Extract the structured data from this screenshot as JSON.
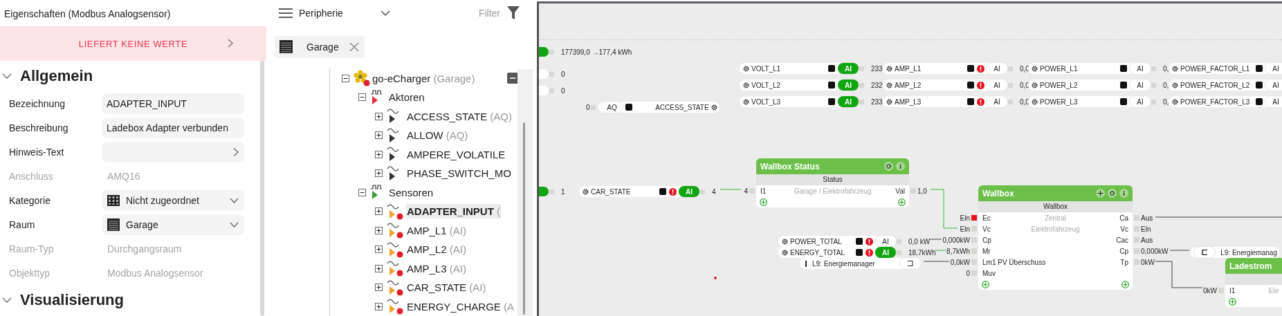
{
  "properties": {
    "title": "Eigenschaften (Modbus Analogsensor)",
    "status": "LIEFERT KEINE WERTE",
    "sections": [
      {
        "title": "Allgemein",
        "expanded": true,
        "fields": [
          {
            "label": "Bezeichnung",
            "value": "ADAPTER_INPUT",
            "kind": "text"
          },
          {
            "label": "Beschreibung",
            "value": "Ladebox Adapter verbunden",
            "kind": "text"
          },
          {
            "label": "Hinweis-Text",
            "kind": "link"
          },
          {
            "label": "Anschluss",
            "value": "AMQ16",
            "kind": "readonly"
          },
          {
            "label": "Kategorie",
            "value": "Nicht zugeordnet",
            "kind": "select"
          },
          {
            "label": "Raum",
            "value": "Garage",
            "kind": "select"
          },
          {
            "label": "Raum-Typ",
            "value": "Durchgangsraum",
            "kind": "readonly"
          },
          {
            "label": "Objekttyp",
            "value": "Modbus Analogsensor",
            "kind": "readonly"
          }
        ]
      },
      {
        "title": "Visualisierung",
        "expanded": true
      }
    ]
  },
  "periphery": {
    "view": "Peripherie",
    "filter": "Filter",
    "chips": [
      {
        "label": "Garage"
      }
    ],
    "tree": [
      {
        "name": "go-eCharger",
        "type": "(Garage)",
        "kind": "device",
        "expanded": true,
        "error": true,
        "selected": false,
        "children": [
          {
            "name": "Aktoren",
            "kind": "actuators",
            "expanded": true,
            "selected": false,
            "children": [
              {
                "name": "ACCESS_STATE",
                "type": "(AQ)",
                "kind": "output",
                "expanded": false,
                "error": false,
                "selected": false
              },
              {
                "name": "ALLOW",
                "type": "(AQ)",
                "kind": "output",
                "expanded": false,
                "error": false,
                "selected": false
              },
              {
                "name": "AMPERE_VOLATILE",
                "kind": "output",
                "expanded": false,
                "error": false,
                "selected": false
              },
              {
                "name": "PHASE_SWITCH_MO",
                "kind": "output",
                "expanded": false,
                "error": false,
                "selected": false
              }
            ]
          },
          {
            "name": "Sensoren",
            "kind": "sensors",
            "expanded": true,
            "selected": false,
            "children": [
              {
                "name": "ADAPTER_INPUT",
                "type": "(",
                "kind": "input",
                "expanded": false,
                "error": true,
                "selected": true
              },
              {
                "name": "AMP_L1",
                "type": "(AI)",
                "kind": "input",
                "expanded": false,
                "error": true,
                "selected": false
              },
              {
                "name": "AMP_L2",
                "type": "(AI)",
                "kind": "input",
                "expanded": false,
                "error": true,
                "selected": false
              },
              {
                "name": "AMP_L3",
                "type": "(AI)",
                "kind": "input",
                "expanded": false,
                "error": true,
                "selected": false
              },
              {
                "name": "CAR_STATE",
                "type": "(AI)",
                "kind": "input",
                "expanded": false,
                "error": true,
                "selected": false
              },
              {
                "name": "ENERGY_CHARGE",
                "type": "(A",
                "kind": "input",
                "expanded": false,
                "error": true,
                "selected": false
              }
            ]
          }
        ]
      }
    ]
  },
  "canvas": {
    "inputs": [
      {
        "value": "177399,0 →177,4  kWh",
        "on": true
      },
      {
        "value": "0",
        "on": false
      },
      {
        "value": "0",
        "on": false
      },
      {
        "value": "1",
        "on": true
      }
    ],
    "objects": [
      {
        "name": "VOLT_L1",
        "kind": "input",
        "type": "AI",
        "active": true,
        "error": false,
        "value": "233"
      },
      {
        "name": "AMP_L1",
        "kind": "input",
        "type": "AI",
        "active": false,
        "error": true,
        "value": "0,0"
      },
      {
        "name": "POWER_L1",
        "kind": "input",
        "type": "AI",
        "active": false,
        "error": false,
        "value": "0,"
      },
      {
        "name": "POWER_FACTOR_L1",
        "kind": "input",
        "type": "AI",
        "active": false,
        "error": false
      },
      {
        "name": "VOLT_L2",
        "kind": "input",
        "type": "AI",
        "active": true,
        "error": false,
        "value": "232"
      },
      {
        "name": "AMP_L2",
        "kind": "input",
        "type": "AI",
        "active": false,
        "error": true,
        "value": "0,0"
      },
      {
        "name": "POWER_L2",
        "kind": "input",
        "type": "AI",
        "active": false,
        "error": false,
        "value": "0,"
      },
      {
        "name": "POWER_FACTOR_L2",
        "kind": "input",
        "type": "AI",
        "active": false,
        "error": false
      },
      {
        "name": "VOLT_L3",
        "kind": "input",
        "type": "AI",
        "active": true,
        "error": false,
        "value": "233"
      },
      {
        "name": "AMP_L3",
        "kind": "input",
        "type": "AI",
        "active": false,
        "error": true,
        "value": "0,0"
      },
      {
        "name": "POWER_L3",
        "kind": "input",
        "type": "AI",
        "active": false,
        "error": false,
        "value": "0,"
      },
      {
        "name": "POWER_FACTOR_L3",
        "kind": "input",
        "type": "AI",
        "active": false,
        "error": false
      },
      {
        "name": "ACCESS_STATE",
        "kind": "output",
        "type": "AQ",
        "active": false,
        "error": false,
        "value": "0"
      },
      {
        "name": "CAR_STATE",
        "kind": "input",
        "type": "AI",
        "active": true,
        "error": true,
        "value": "4"
      },
      {
        "name": "POWER_TOTAL",
        "kind": "input",
        "type": "AI",
        "active": false,
        "error": true,
        "value": "0,0 kW"
      },
      {
        "name": "ENERGY_TOTAL",
        "kind": "input",
        "type": "AI",
        "active": true,
        "error": true,
        "value": "18,7kWh"
      },
      {
        "name": "L9: Energiemanager",
        "kind": "reference-in"
      },
      {
        "name": "L9: Energiemanag",
        "kind": "reference-out"
      }
    ],
    "blocks": [
      {
        "title": "Wallbox Status",
        "subtitle": "Status",
        "movable": false,
        "notes": [
          "Garage / Elektrofahrzeug"
        ],
        "inputs": [
          {
            "label": "I1",
            "value": "4",
            "error": false
          }
        ],
        "outputs": [
          {
            "label": "Val",
            "value": "1,0"
          }
        ]
      },
      {
        "title": "Wallbox",
        "subtitle": "Wallbox",
        "movable": true,
        "notes": [
          "Zentral",
          "Elektrofahrzeug"
        ],
        "inputs": [
          {
            "label": "Ec",
            "value": "Eln",
            "error": true
          },
          {
            "label": "Vc",
            "value": "Eln",
            "error": false
          },
          {
            "label": "Cp",
            "value": "0,000kW",
            "error": false
          },
          {
            "label": "Mr",
            "value": "8,7kWh",
            "error": false
          },
          {
            "label": "Lm1 PV Überschuss",
            "value": "0,0kW",
            "error": false
          },
          {
            "label": "Muv",
            "value": "0",
            "error": false
          }
        ],
        "outputs": [
          {
            "label": "Ca",
            "value": "Aus"
          },
          {
            "label": "Vc",
            "value": "Eln"
          },
          {
            "label": "Cac",
            "value": "Aus"
          },
          {
            "label": "Cp",
            "value": "0,000kW"
          },
          {
            "label": "Tp",
            "value": "0kW"
          }
        ]
      },
      {
        "title": "Ladestrom",
        "movable": false,
        "notes": [
          "Ele"
        ],
        "inputs": [
          {
            "label": "I1",
            "value": "0kW",
            "error": false
          }
        ]
      }
    ]
  }
}
